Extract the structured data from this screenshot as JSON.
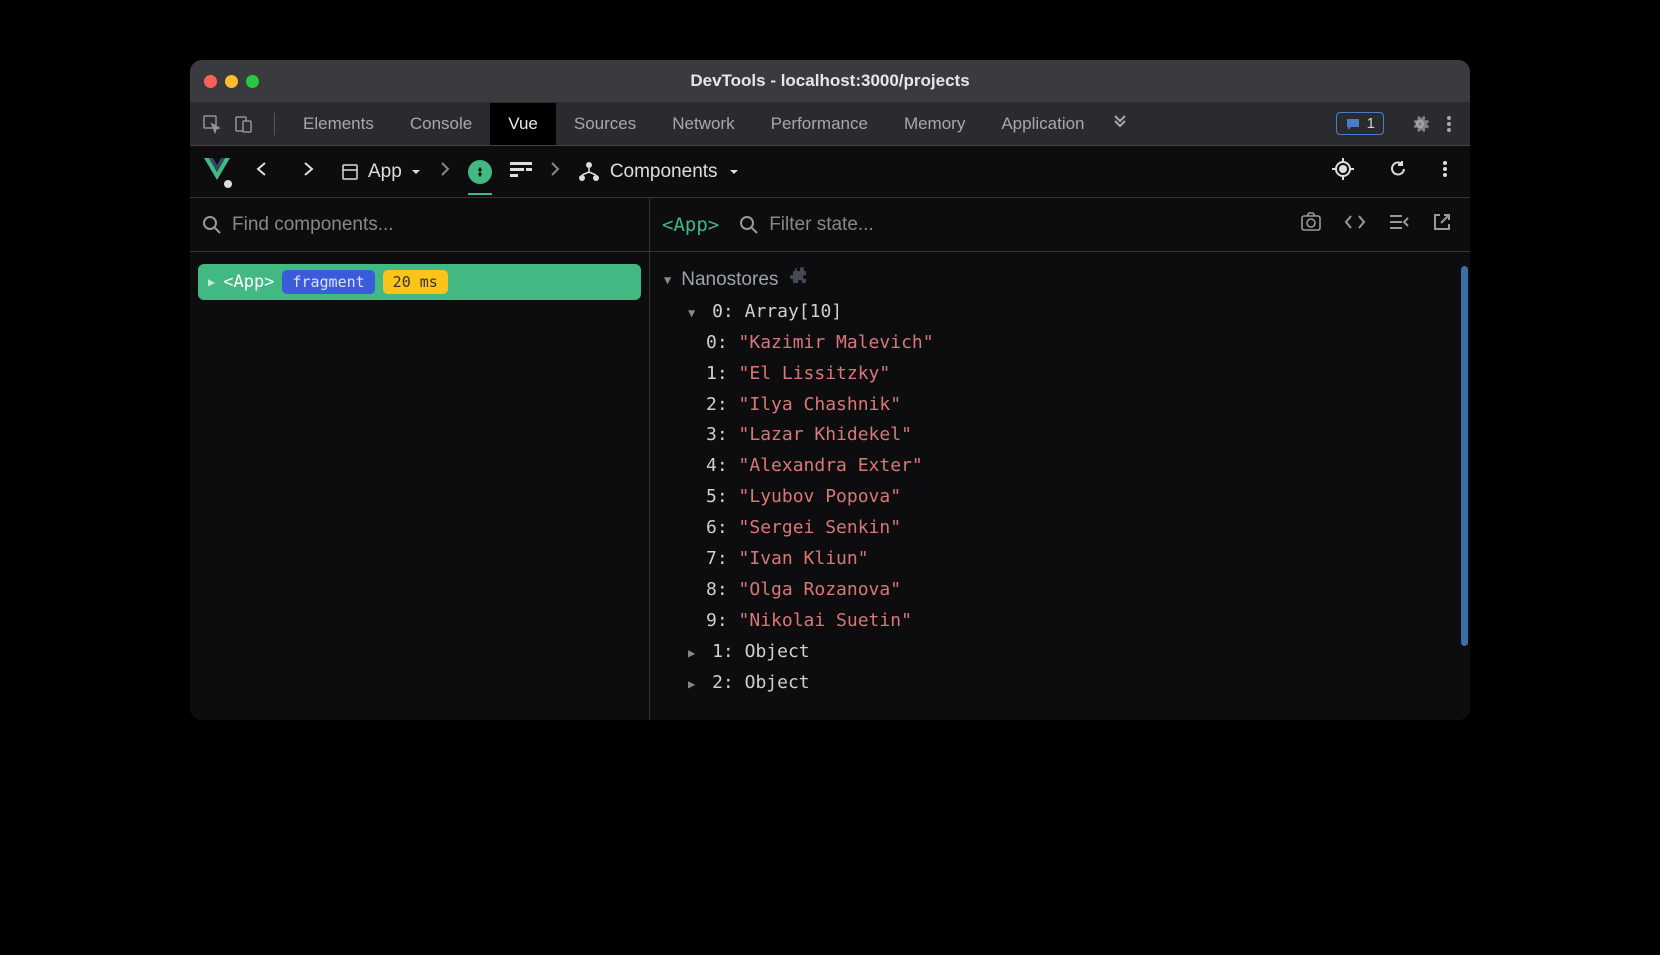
{
  "window": {
    "title": "DevTools - localhost:3000/projects"
  },
  "tabs": {
    "items": [
      "Elements",
      "Console",
      "Vue",
      "Sources",
      "Network",
      "Performance",
      "Memory",
      "Application"
    ],
    "active": "Vue",
    "badge_count": "1"
  },
  "vue_toolbar": {
    "app_label": "App",
    "components_label": "Components"
  },
  "left": {
    "search_placeholder": "Find components...",
    "node": {
      "tag": "<App>",
      "badge": "fragment",
      "timing": "20 ms"
    }
  },
  "right": {
    "app_tag": "<App>",
    "filter_placeholder": "Filter state...",
    "section_label": "Nanostores",
    "array": {
      "key": "0",
      "type": "Array[10]",
      "items": [
        "\"Kazimir Malevich\"",
        "\"El Lissitzky\"",
        "\"Ilya Chashnik\"",
        "\"Lazar Khidekel\"",
        "\"Alexandra Exter\"",
        "\"Lyubov Popova\"",
        "\"Sergei Senkin\"",
        "\"Ivan Kliun\"",
        "\"Olga Rozanova\"",
        "\"Nikolai Suetin\""
      ]
    },
    "collapsed": [
      {
        "key": "1",
        "type": "Object"
      },
      {
        "key": "2",
        "type": "Object"
      }
    ]
  }
}
